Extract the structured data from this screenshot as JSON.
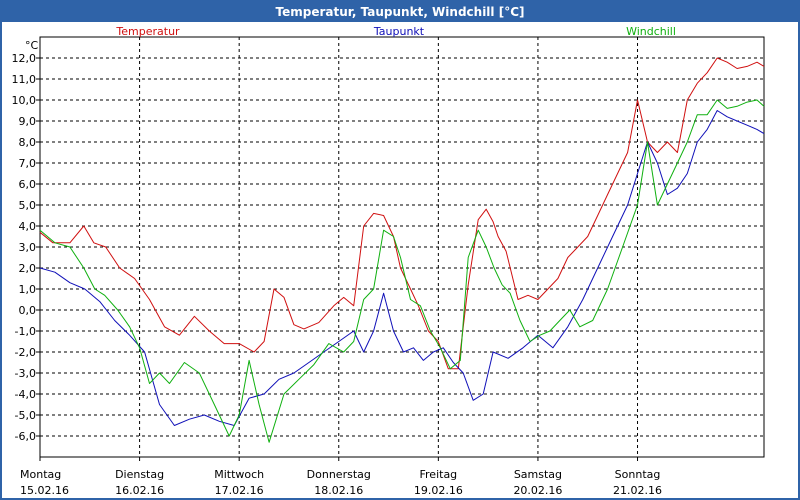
{
  "window": {
    "title": "Temperatur, Taupunkt, Windchill [°C]"
  },
  "chart_data": {
    "type": "line",
    "unit_label": "°C",
    "ylim": [
      -7,
      13
    ],
    "y_ticks": [
      "12,0",
      "11,0",
      "10,0",
      "9,0",
      "8,0",
      "7,0",
      "6,0",
      "5,0",
      "4,0",
      "3,0",
      "2,0",
      "1,0",
      "0,0",
      "-1,0",
      "-2,0",
      "-3,0",
      "-4,0",
      "-5,0",
      "-6,0"
    ],
    "y_tick_values": [
      12,
      11,
      10,
      9,
      8,
      7,
      6,
      5,
      4,
      3,
      2,
      1,
      0,
      -1,
      -2,
      -3,
      -4,
      -5,
      -6
    ],
    "x_range": [
      0,
      7.27
    ],
    "x_ticks": [
      {
        "day": "Montag",
        "date": "15.02.16",
        "x": 0
      },
      {
        "day": "Dienstag",
        "date": "16.02.16",
        "x": 1
      },
      {
        "day": "Mittwoch",
        "date": "17.02.16",
        "x": 2
      },
      {
        "day": "Donnerstag",
        "date": "18.02.16",
        "x": 3
      },
      {
        "day": "Freitag",
        "date": "19.02.16",
        "x": 4
      },
      {
        "day": "Samstag",
        "date": "20.02.16",
        "x": 5
      },
      {
        "day": "Sonntag",
        "date": "21.02.16",
        "x": 6
      }
    ],
    "grid": true,
    "series": [
      {
        "name": "Temperatur",
        "color": "#d01010",
        "x": [
          0,
          0.13,
          0.3,
          0.44,
          0.54,
          0.66,
          0.8,
          0.95,
          1.1,
          1.25,
          1.4,
          1.55,
          1.7,
          1.85,
          2.0,
          2.15,
          2.25,
          2.35,
          2.45,
          2.55,
          2.65,
          2.8,
          2.95,
          3.05,
          3.15,
          3.25,
          3.35,
          3.45,
          3.55,
          3.62,
          3.72,
          3.8,
          3.9,
          4.0,
          4.1,
          4.2,
          4.3,
          4.4,
          4.48,
          4.55,
          4.6,
          4.68,
          4.8,
          4.9,
          5.0,
          5.1,
          5.2,
          5.3,
          5.4,
          5.5,
          5.6,
          5.7,
          5.8,
          5.9,
          6.0,
          6.1,
          6.2,
          6.3,
          6.4,
          6.5,
          6.6,
          6.7,
          6.8,
          6.9,
          7.0,
          7.1,
          7.2,
          7.27
        ],
        "y": [
          3.7,
          3.2,
          3.2,
          4.0,
          3.2,
          3.0,
          2.0,
          1.5,
          0.5,
          -0.8,
          -1.2,
          -0.3,
          -1.0,
          -1.6,
          -1.6,
          -2.0,
          -1.5,
          1.0,
          0.6,
          -0.7,
          -0.9,
          -0.6,
          0.2,
          0.6,
          0.2,
          4.0,
          4.6,
          4.5,
          3.5,
          2.0,
          1.0,
          0.2,
          -1.0,
          -1.5,
          -2.8,
          -2.8,
          1.2,
          4.3,
          4.8,
          4.2,
          3.5,
          2.8,
          0.5,
          0.7,
          0.5,
          1.0,
          1.5,
          2.5,
          3.0,
          3.5,
          4.5,
          5.5,
          6.5,
          7.5,
          10.0,
          8.0,
          7.5,
          8.0,
          7.5,
          10.0,
          10.8,
          11.3,
          12.0,
          11.8,
          11.5,
          11.6,
          11.8,
          11.6
        ]
      },
      {
        "name": "Taupunkt",
        "color": "#1010b8",
        "x": [
          0,
          0.15,
          0.3,
          0.45,
          0.6,
          0.75,
          0.9,
          1.05,
          1.2,
          1.35,
          1.5,
          1.65,
          1.8,
          1.95,
          2.1,
          2.25,
          2.4,
          2.55,
          2.7,
          2.85,
          3.0,
          3.15,
          3.25,
          3.35,
          3.45,
          3.55,
          3.65,
          3.75,
          3.85,
          3.95,
          4.05,
          4.15,
          4.25,
          4.35,
          4.45,
          4.55,
          4.7,
          4.85,
          5.0,
          5.15,
          5.3,
          5.45,
          5.6,
          5.75,
          5.9,
          6.0,
          6.1,
          6.2,
          6.3,
          6.4,
          6.5,
          6.6,
          6.7,
          6.8,
          6.9,
          7.0,
          7.1,
          7.2,
          7.27
        ],
        "y": [
          2.0,
          1.8,
          1.3,
          1.0,
          0.4,
          -0.5,
          -1.2,
          -2.0,
          -4.5,
          -5.5,
          -5.2,
          -5.0,
          -5.3,
          -5.5,
          -4.2,
          -4.0,
          -3.3,
          -3.0,
          -2.5,
          -2.0,
          -1.5,
          -1.0,
          -2.0,
          -1.0,
          0.8,
          -1.0,
          -2.0,
          -1.8,
          -2.4,
          -2.0,
          -1.8,
          -2.5,
          -3.0,
          -4.3,
          -4.0,
          -2.0,
          -2.3,
          -1.8,
          -1.2,
          -1.8,
          -0.8,
          0.5,
          2.0,
          3.5,
          5.0,
          6.5,
          8.0,
          7.0,
          5.5,
          5.8,
          6.5,
          8.0,
          8.6,
          9.5,
          9.2,
          9.0,
          8.8,
          8.6,
          8.4
        ]
      },
      {
        "name": "Windchill",
        "color": "#10b010",
        "x": [
          0,
          0.15,
          0.3,
          0.44,
          0.55,
          0.65,
          0.78,
          0.9,
          1.0,
          1.1,
          1.2,
          1.3,
          1.45,
          1.6,
          1.75,
          1.9,
          2.0,
          2.1,
          2.2,
          2.3,
          2.45,
          2.6,
          2.75,
          2.9,
          3.05,
          3.15,
          3.25,
          3.35,
          3.45,
          3.55,
          3.62,
          3.72,
          3.82,
          3.92,
          4.02,
          4.12,
          4.22,
          4.3,
          4.4,
          4.48,
          4.56,
          4.64,
          4.72,
          4.82,
          4.92,
          5.02,
          5.12,
          5.22,
          5.32,
          5.42,
          5.55,
          5.7,
          5.85,
          6.0,
          6.1,
          6.2,
          6.3,
          6.4,
          6.5,
          6.6,
          6.7,
          6.8,
          6.9,
          7.0,
          7.1,
          7.2,
          7.27
        ],
        "y": [
          3.8,
          3.2,
          3.0,
          2.0,
          1.0,
          0.7,
          0.0,
          -0.8,
          -1.8,
          -3.5,
          -3.0,
          -3.5,
          -2.5,
          -3.0,
          -4.5,
          -6.0,
          -5.0,
          -2.4,
          -4.5,
          -6.3,
          -4.0,
          -3.3,
          -2.6,
          -1.6,
          -2.0,
          -1.5,
          0.5,
          1.0,
          3.8,
          3.5,
          2.5,
          0.5,
          0.2,
          -1.0,
          -1.8,
          -2.8,
          -2.4,
          2.5,
          3.8,
          3.0,
          2.0,
          1.2,
          0.8,
          -0.5,
          -1.5,
          -1.2,
          -1.0,
          -0.5,
          0.0,
          -0.8,
          -0.5,
          1.0,
          3.0,
          5.0,
          8.0,
          5.0,
          6.0,
          7.0,
          8.0,
          9.3,
          9.3,
          10.0,
          9.6,
          9.7,
          9.9,
          10.0,
          9.7
        ]
      }
    ]
  }
}
